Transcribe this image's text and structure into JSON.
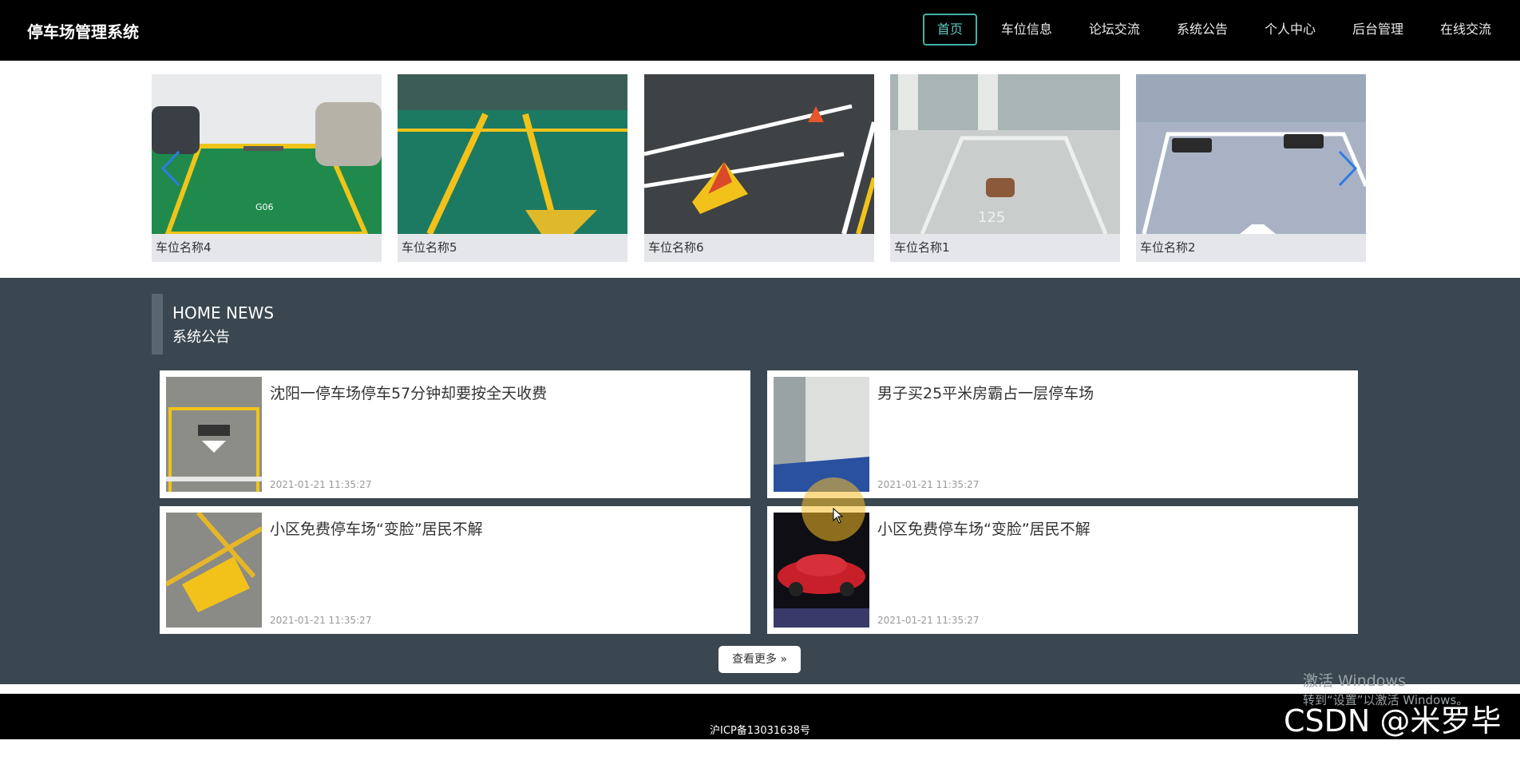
{
  "header": {
    "brand": "停车场管理系统",
    "nav": [
      "首页",
      "车位信息",
      "论坛交流",
      "系统公告",
      "个人中心",
      "后台管理",
      "在线交流"
    ],
    "active_index": 0,
    "accent_color": "#3fb2a5"
  },
  "carousel": {
    "items": [
      {
        "caption": "车位名称4"
      },
      {
        "caption": "车位名称5"
      },
      {
        "caption": "车位名称6"
      },
      {
        "caption": "车位名称1"
      },
      {
        "caption": "车位名称2"
      }
    ],
    "prev_icon": "chevron-left-icon",
    "next_icon": "chevron-right-icon"
  },
  "news": {
    "title_en": "HOME NEWS",
    "title_cn": "系统公告",
    "items": [
      {
        "title": "沈阳一停车场停车57分钟却要按全天收费",
        "date": "2021-01-21 11:35:27"
      },
      {
        "title": "男子买25平米房霸占一层停车场",
        "date": "2021-01-21 11:35:27"
      },
      {
        "title": "小区免费停车场“变脸”居民不解",
        "date": "2021-01-21 11:35:27"
      },
      {
        "title": "小区免费停车场“变脸”居民不解",
        "date": "2021-01-21 11:35:27"
      }
    ],
    "more_label": "查看更多",
    "background_color": "#3a4750"
  },
  "footer": {
    "icp": "沪ICP备13031638号"
  },
  "overlay": {
    "activate_line1": "激活 Windows",
    "activate_line2": "转到“设置”以激活 Windows。",
    "watermark": "CSDN @米罗毕设"
  }
}
